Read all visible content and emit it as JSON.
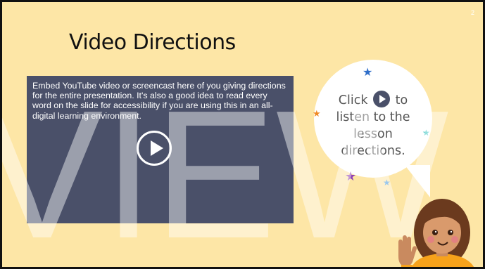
{
  "slide": {
    "page_number": "2",
    "title": "Video Directions",
    "background_color": "#fde6a6"
  },
  "video": {
    "placeholder_text": "Embed YouTube video or screencast here of you giving directions for the entire presentation.  It's also a good idea to read every word on the slide for accessibility if you are using this in an all-digital learning environment.",
    "play_icon": "play-circle-icon",
    "box_color": "#4a5069"
  },
  "bubble": {
    "line1_before": "Click",
    "line1_after": "to",
    "line2": "listen to the",
    "line3": "lesson",
    "line4": "directions.",
    "play_icon": "play-icon"
  },
  "watermark": {
    "text": "VIEW"
  },
  "decorations": {
    "stars": [
      {
        "name": "blue-star-icon",
        "color": "#2f6ec9"
      },
      {
        "name": "orange-star-icon",
        "color": "#f08a24"
      },
      {
        "name": "teal-star-icon",
        "color": "#3ec5c2"
      },
      {
        "name": "purple-star-icon",
        "color": "#8e3fb5"
      },
      {
        "name": "light-blue-star-icon",
        "color": "#4a9be0"
      }
    ],
    "character": "waving-girl-illustration"
  }
}
